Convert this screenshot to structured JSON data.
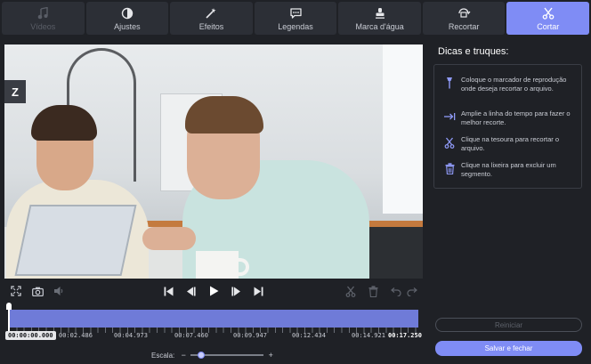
{
  "tabs": [
    {
      "label": "Vídeos",
      "icon": "music-note-icon",
      "state": "disabled"
    },
    {
      "label": "Ajustes",
      "icon": "contrast-icon",
      "state": "normal"
    },
    {
      "label": "Efeitos",
      "icon": "magic-wand-icon",
      "state": "normal"
    },
    {
      "label": "Legendas",
      "icon": "speech-bubble-icon",
      "state": "normal"
    },
    {
      "label": "Marca d'água",
      "icon": "stamp-icon",
      "state": "normal"
    },
    {
      "label": "Recortar",
      "icon": "crop-rotate-icon",
      "state": "normal"
    },
    {
      "label": "Cortar",
      "icon": "scissors-icon",
      "state": "active"
    }
  ],
  "player": {
    "controls_left": [
      "fullscreen-icon",
      "camera-icon",
      "volume-icon"
    ],
    "controls_center": [
      "skip-start-icon",
      "prev-frame-icon",
      "play-icon",
      "next-frame-icon",
      "skip-end-icon"
    ],
    "controls_right": [
      "scissors-icon",
      "trash-icon",
      "undo-icon",
      "redo-icon"
    ]
  },
  "timeline": {
    "current_time": "00:00:00.000",
    "markers": [
      "00:02.486",
      "00:04.973",
      "00:07.460",
      "00:09.947",
      "00:12.434",
      "00:14.921"
    ],
    "end_time": "00:17.250",
    "scale_label": "Escala:",
    "scale_minus": "−",
    "scale_plus": "+",
    "scale_level": 0.1
  },
  "tips": {
    "title": "Dicas e truques:",
    "items": [
      {
        "icon": "marker-pin-icon",
        "text": "Coloque o marcador de reprodução onde deseja recortar o arquivo."
      },
      {
        "icon": "expand-arrow-icon",
        "text": "Amplie a linha do tempo para fazer o melhor recorte."
      },
      {
        "icon": "scissors-icon",
        "text": "Clique na tesoura para recortar o arquivo."
      },
      {
        "icon": "trash-icon",
        "text": "Clique na lixeira para excluir um segmento."
      }
    ]
  },
  "buttons": {
    "reset": "Reiniciar",
    "save": "Salvar e fechar"
  },
  "colors": {
    "accent": "#7f8cf5",
    "background": "#1f2126",
    "tab": "#2c2f36"
  }
}
